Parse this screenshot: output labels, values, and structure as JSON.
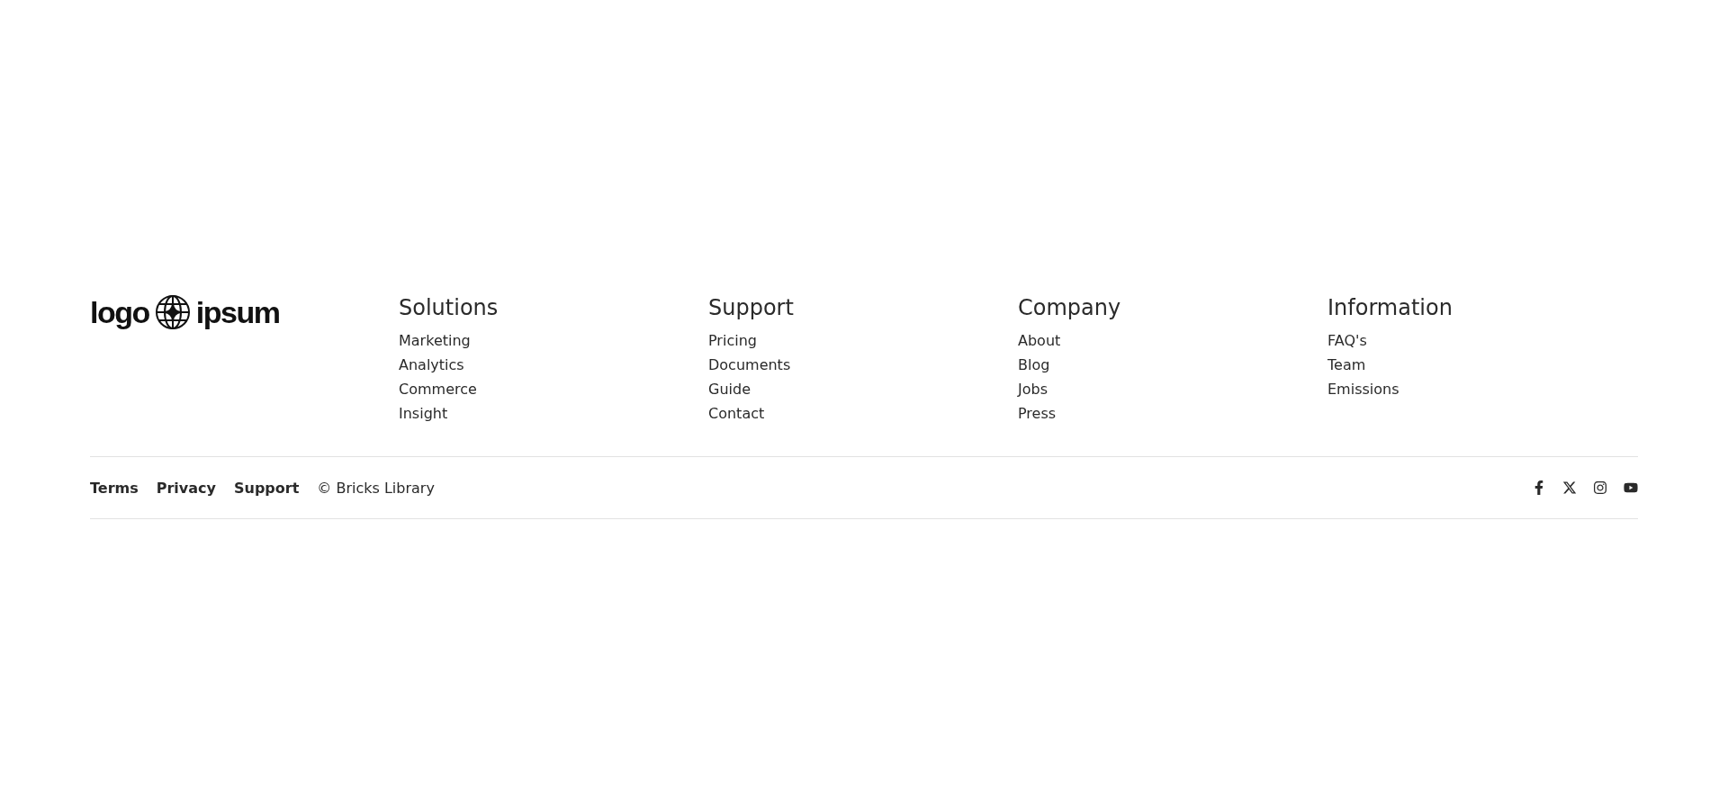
{
  "logo": {
    "words": [
      "logo",
      "ipsum"
    ]
  },
  "columns": [
    {
      "heading": "Solutions",
      "links": [
        "Marketing",
        "Analytics",
        "Commerce",
        "Insight"
      ]
    },
    {
      "heading": "Support",
      "links": [
        "Pricing",
        "Documents",
        "Guide",
        "Contact"
      ]
    },
    {
      "heading": "Company",
      "links": [
        "About",
        "Blog",
        "Jobs",
        "Press"
      ]
    },
    {
      "heading": "Information",
      "links": [
        "FAQ's",
        "Team",
        "Emissions"
      ]
    }
  ],
  "bottom_links": [
    "Terms",
    "Privacy",
    "Support"
  ],
  "copyright": "© Bricks Library"
}
